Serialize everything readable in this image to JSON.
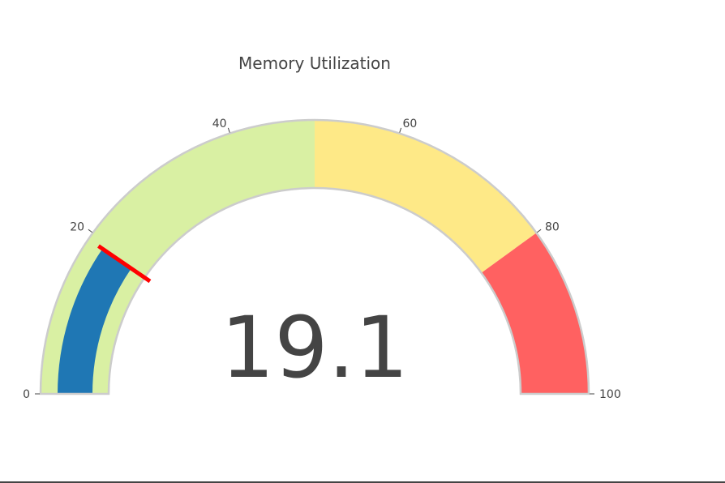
{
  "chart_data": {
    "type": "gauge",
    "title": "Memory Utilization",
    "value": 19.1,
    "value_label": "19.1",
    "range": [
      0,
      100
    ],
    "ticks": [
      {
        "value": 0,
        "label": "0"
      },
      {
        "value": 20,
        "label": "20"
      },
      {
        "value": 40,
        "label": "40"
      },
      {
        "value": 60,
        "label": "60"
      },
      {
        "value": 80,
        "label": "80"
      },
      {
        "value": 100,
        "label": "100"
      }
    ],
    "steps": [
      {
        "range": [
          0,
          50
        ],
        "color": "#d9f0a3"
      },
      {
        "range": [
          50,
          80
        ],
        "color": "#fee987"
      },
      {
        "range": [
          80,
          100
        ],
        "color": "#ff6161"
      }
    ],
    "bar": {
      "value": 19.1,
      "color": "#1f77b4"
    },
    "threshold": {
      "value": 19.1,
      "color": "#ff0000"
    },
    "border_color": "#cccccc"
  }
}
